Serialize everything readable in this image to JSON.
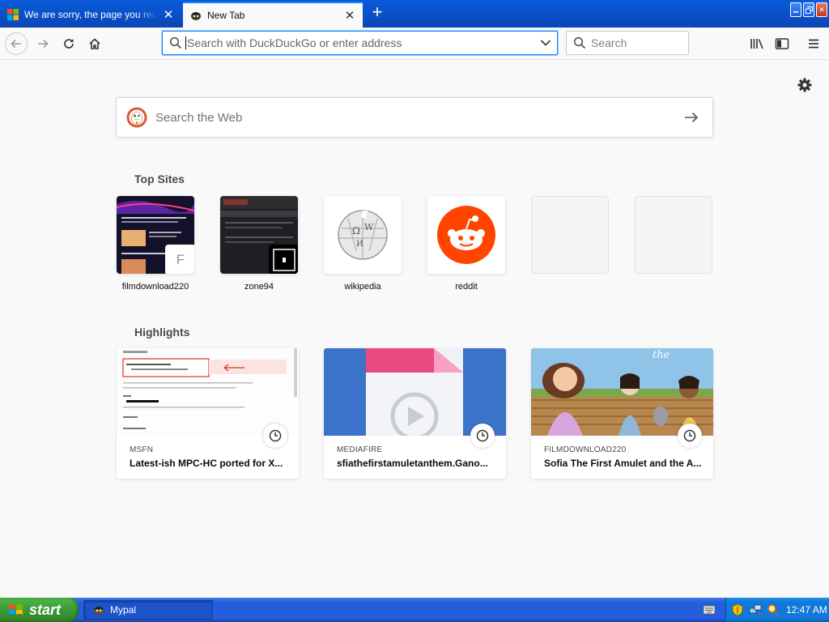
{
  "tabs": [
    {
      "title": "We are sorry, the page you requested cannot be found",
      "active": false
    },
    {
      "title": "New Tab",
      "active": true
    }
  ],
  "toolbar": {
    "url_placeholder": "Search with DuckDuckGo or enter address",
    "search_placeholder": "Search"
  },
  "newtab": {
    "web_search_placeholder": "Search the Web",
    "top_sites_heading": "Top Sites",
    "highlights_heading": "Highlights",
    "top_sites": [
      {
        "label": "filmdownload220",
        "badge": "F"
      },
      {
        "label": "zone94"
      },
      {
        "label": "wikipedia"
      },
      {
        "label": "reddit"
      }
    ],
    "highlights": [
      {
        "source": "MSFN",
        "title": "Latest-ish MPC-HC ported for X..."
      },
      {
        "source": "MEDIAFIRE",
        "title": "sfiathefirstamuletanthem.Gano..."
      },
      {
        "source": "FILMDOWNLOAD220",
        "title": "Sofia The First Amulet and the A..."
      }
    ]
  },
  "taskbar": {
    "start_label": "start",
    "task_label": "Mypal",
    "clock": "12:47 AM"
  },
  "colors": {
    "accent": "#0a84ff",
    "reddit": "#ff4500",
    "duckduckgo": "#de5833",
    "xp_blue": "#245edb",
    "start_green": "#3c9a36"
  },
  "icons": [
    "windows-flag-icon",
    "pirate-favicon-icon",
    "close-icon",
    "plus-icon",
    "back-icon",
    "forward-icon",
    "reload-icon",
    "home-icon",
    "search-icon",
    "chevron-down-icon",
    "library-icon",
    "sidebar-icon",
    "menu-icon",
    "gear-icon",
    "duckduckgo-icon",
    "arrow-right-icon",
    "wikipedia-icon",
    "reddit-icon",
    "clock-icon",
    "keyboard-icon",
    "shield-icon",
    "network-icon"
  ]
}
